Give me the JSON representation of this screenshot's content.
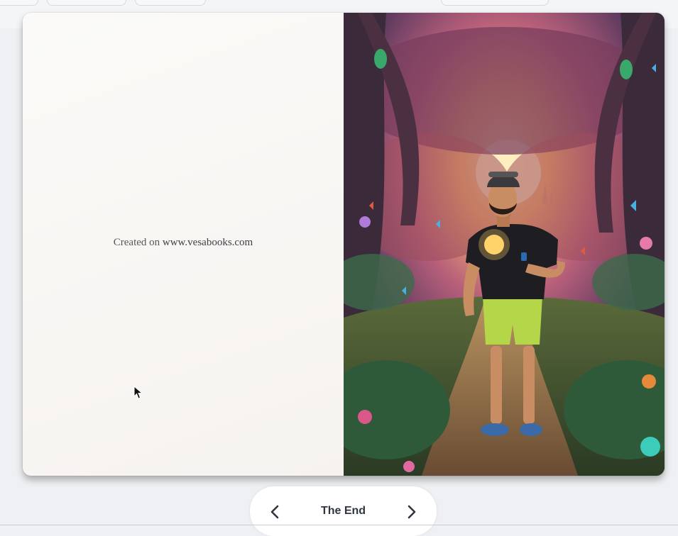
{
  "book": {
    "left_page": {
      "credit_prefix": "Created on",
      "credit_url": "www.vesabooks.com"
    },
    "right_page": {
      "illustration": "man in cap and black t-shirt holding glowing compass on forest path at sunset"
    }
  },
  "navigation": {
    "title": "The End",
    "prev_icon": "chevron-left-icon",
    "next_icon": "chevron-right-icon"
  },
  "colors": {
    "nav_text": "#2f3640",
    "page_bg": "#f9f7f4",
    "app_bg": "#eef0f3"
  }
}
